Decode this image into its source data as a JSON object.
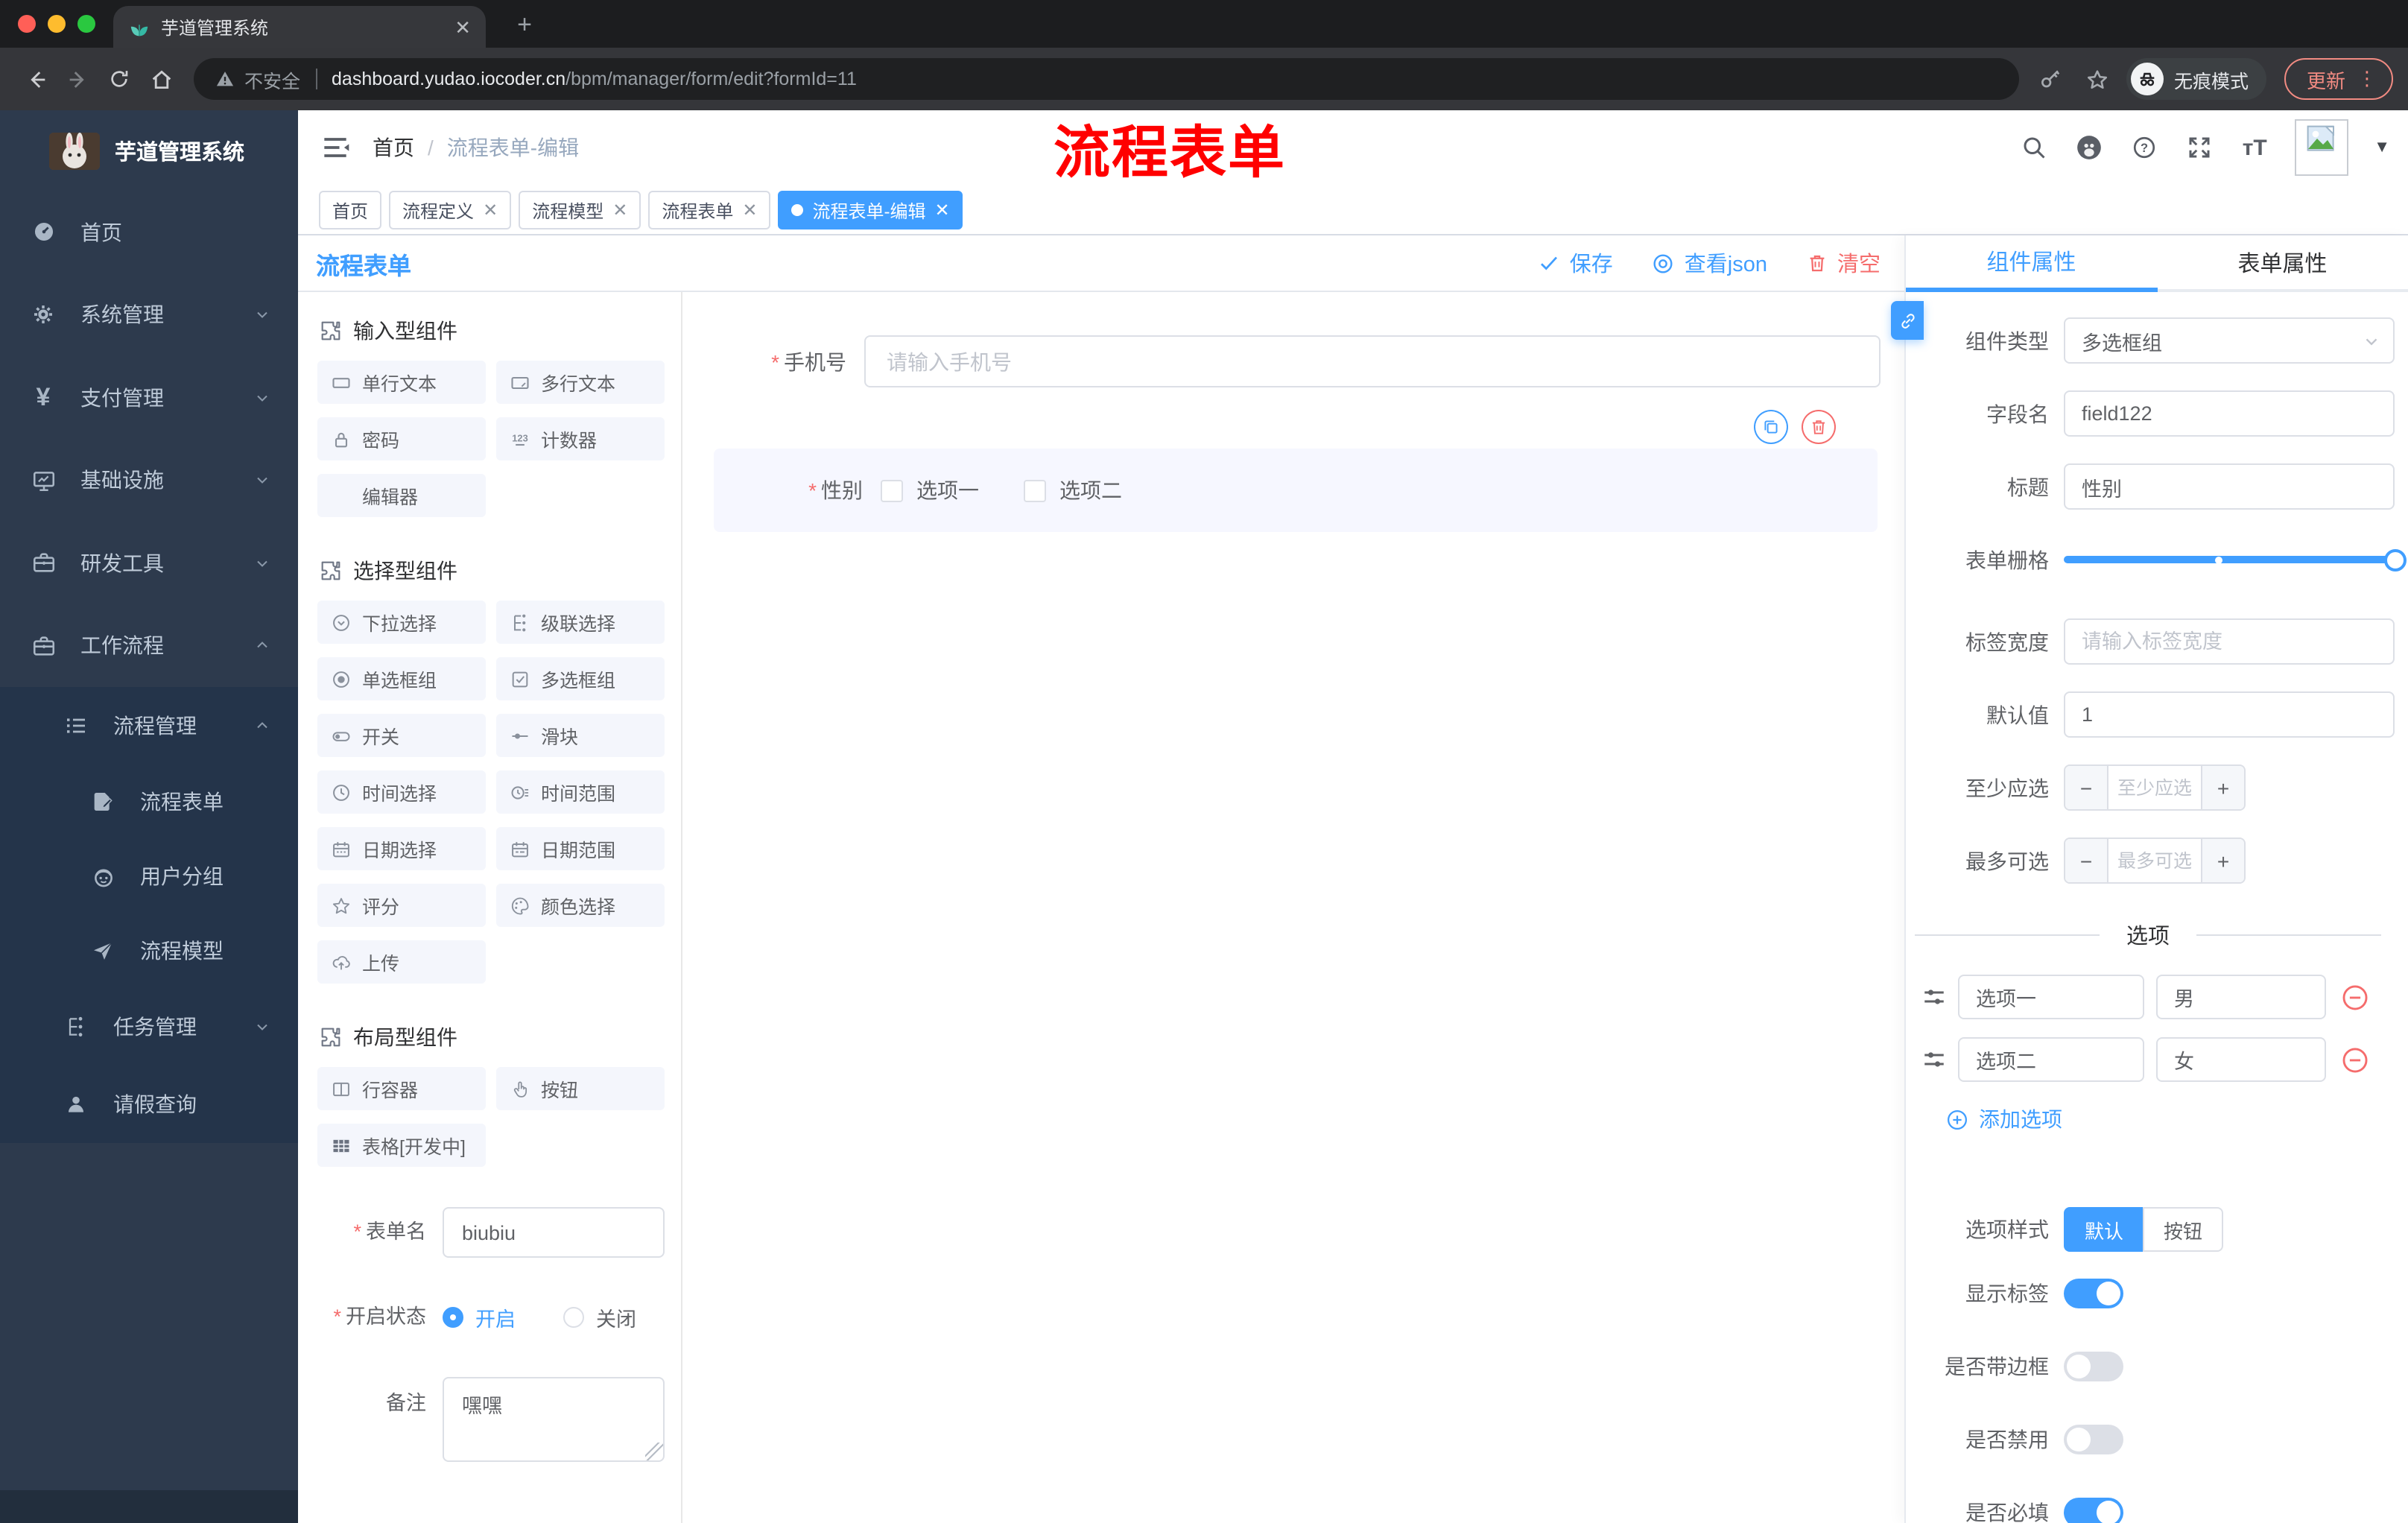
{
  "browser": {
    "tab_title": "芋道管理系统",
    "not_secure": "不安全",
    "url_host": "dashboard.yudao.iocoder.cn",
    "url_path": "/bpm/manager/form/edit?formId=11",
    "incognito": "无痕模式",
    "update": "更新"
  },
  "sidebar": {
    "title": "芋道管理系统",
    "items": [
      {
        "label": "首页",
        "icon": "dashboard-icon"
      },
      {
        "label": "系统管理",
        "icon": "gear-icon"
      },
      {
        "label": "支付管理",
        "icon": "yen-icon"
      },
      {
        "label": "基础设施",
        "icon": "monitor-icon"
      },
      {
        "label": "研发工具",
        "icon": "toolbox-icon"
      },
      {
        "label": "工作流程",
        "icon": "briefcase-icon"
      }
    ],
    "sub": [
      {
        "label": "流程管理",
        "icon": "flow-list-icon"
      },
      {
        "label": "流程表单",
        "icon": "doc-edit-icon"
      },
      {
        "label": "用户分组",
        "icon": "robot-icon"
      },
      {
        "label": "流程模型",
        "icon": "paper-plane-icon"
      },
      {
        "label": "任务管理",
        "icon": "tree-icon"
      },
      {
        "label": "请假查询",
        "icon": "person-icon"
      }
    ]
  },
  "header": {
    "crumb1": "首页",
    "crumb2": "流程表单-编辑",
    "annotation": "流程表单"
  },
  "tags": [
    {
      "label": "首页"
    },
    {
      "label": "流程定义"
    },
    {
      "label": "流程模型"
    },
    {
      "label": "流程表单"
    },
    {
      "label": "流程表单-编辑"
    }
  ],
  "designer": {
    "title": "流程表单",
    "save": "保存",
    "view_json": "查看json",
    "clear": "清空"
  },
  "components": {
    "sec_input": "输入型组件",
    "sec_select": "选择型组件",
    "sec_layout": "布局型组件",
    "input_items": [
      {
        "label": "单行文本",
        "icon": "input-icon"
      },
      {
        "label": "多行文本",
        "icon": "textarea-icon"
      },
      {
        "label": "密码",
        "icon": "lock-icon"
      },
      {
        "label": "计数器",
        "icon": "counter-icon"
      },
      {
        "label": "编辑器",
        "icon": "none"
      }
    ],
    "select_items": [
      {
        "label": "下拉选择",
        "icon": "select-icon"
      },
      {
        "label": "级联选择",
        "icon": "cascader-icon"
      },
      {
        "label": "单选框组",
        "icon": "radio-icon"
      },
      {
        "label": "多选框组",
        "icon": "checkbox-icon"
      },
      {
        "label": "开关",
        "icon": "switch-icon"
      },
      {
        "label": "滑块",
        "icon": "slider-icon"
      },
      {
        "label": "时间选择",
        "icon": "clock-icon"
      },
      {
        "label": "时间范围",
        "icon": "clock-range-icon"
      },
      {
        "label": "日期选择",
        "icon": "calendar-icon"
      },
      {
        "label": "日期范围",
        "icon": "calendar-range-icon"
      },
      {
        "label": "评分",
        "icon": "star-icon"
      },
      {
        "label": "颜色选择",
        "icon": "palette-icon"
      },
      {
        "label": "上传",
        "icon": "upload-icon"
      }
    ],
    "layout_items": [
      {
        "label": "行容器",
        "icon": "columns-icon"
      },
      {
        "label": "按钮",
        "icon": "pointer-icon"
      },
      {
        "label": "表格[开发中]",
        "icon": "table-icon"
      }
    ]
  },
  "meta": {
    "form_name_label": "表单名",
    "form_name_value": "biubiu",
    "status_label": "开启状态",
    "status_on": "开启",
    "status_off": "关闭",
    "remark_label": "备注",
    "remark_value": "嘿嘿"
  },
  "canvas": {
    "phone_label": "手机号",
    "phone_placeholder": "请输入手机号",
    "gender_label": "性别",
    "opt1": "选项一",
    "opt2": "选项二"
  },
  "props": {
    "tab_component": "组件属性",
    "tab_form": "表单属性",
    "type_label": "组件类型",
    "type_value": "多选框组",
    "field_label": "字段名",
    "field_value": "field122",
    "title_label": "标题",
    "title_value": "性别",
    "grid_label": "表单栅格",
    "labelw_label": "标签宽度",
    "labelw_placeholder": "请输入标签宽度",
    "default_label": "默认值",
    "default_value": "1",
    "min_label": "至少应选",
    "min_placeholder": "至少应选",
    "max_label": "最多可选",
    "max_placeholder": "最多可选",
    "options_title": "选项",
    "options": [
      {
        "label": "选项一",
        "value": "男"
      },
      {
        "label": "选项二",
        "value": "女"
      }
    ],
    "add_option": "添加选项",
    "style_label": "选项样式",
    "style_default": "默认",
    "style_button": "按钮",
    "toggles": [
      {
        "label": "显示标签",
        "on": true
      },
      {
        "label": "是否带边框",
        "on": false
      },
      {
        "label": "是否禁用",
        "on": false
      },
      {
        "label": "是否必填",
        "on": true
      }
    ]
  },
  "colors": {
    "accent": "#409eff",
    "danger": "#f56c6c",
    "sidebar_bg": "#2d3a4d",
    "chip_bg": "#f4f6fc",
    "selected_block_bg": "#f6f7ff"
  }
}
